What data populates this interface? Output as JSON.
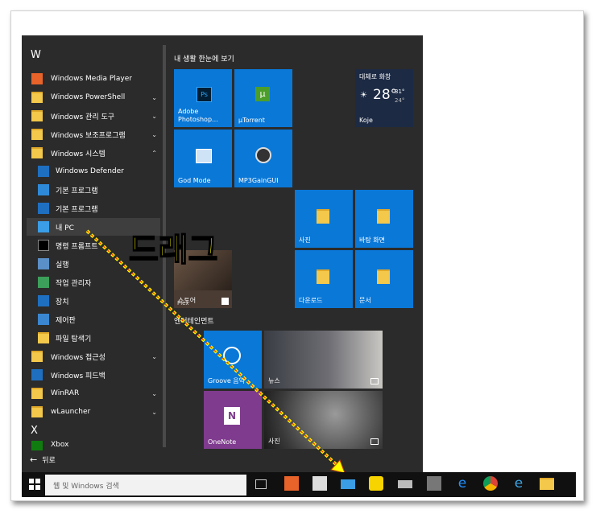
{
  "applist": {
    "group_w": "W",
    "group_x": "X",
    "items": [
      {
        "label": "Windows Media Player",
        "chev": ""
      },
      {
        "label": "Windows PowerShell",
        "chev": "⌄"
      },
      {
        "label": "Windows 관리 도구",
        "chev": "⌄"
      },
      {
        "label": "Windows 보조프로그램",
        "chev": "⌄"
      },
      {
        "label": "Windows 시스템",
        "chev": "⌃"
      },
      {
        "label": "Windows Defender",
        "chev": ""
      },
      {
        "label": "기본 프로그램",
        "chev": ""
      },
      {
        "label": "기본 프로그램",
        "chev": ""
      },
      {
        "label": "내 PC",
        "chev": ""
      },
      {
        "label": "명령 프롬프트",
        "chev": ""
      },
      {
        "label": "실행",
        "chev": ""
      },
      {
        "label": "작업 관리자",
        "chev": ""
      },
      {
        "label": "장치",
        "chev": ""
      },
      {
        "label": "제어판",
        "chev": ""
      },
      {
        "label": "파일 탐색기",
        "chev": ""
      },
      {
        "label": "Windows 접근성",
        "chev": "⌄"
      },
      {
        "label": "Windows 피드백",
        "chev": ""
      },
      {
        "label": "WinRAR",
        "chev": "⌄"
      },
      {
        "label": "wLauncher",
        "chev": "⌄"
      },
      {
        "label": "Xbox",
        "chev": ""
      }
    ],
    "back": "뒤로"
  },
  "tiles": {
    "section1": "내 생활 한눈에 보기",
    "section2": "엔터테인먼트",
    "photoshop": "Adobe Photoshop...",
    "utorrent": "µTorrent",
    "godmode": "God Mode",
    "mp3gain": "MP3GainGUI",
    "weather_title": "대체로 화창",
    "weather_temp": "28°",
    "weather_hi": "31°",
    "weather_lo": "24°",
    "weather_city": "Koje",
    "photos": "사진",
    "wallpaper": "바탕 화면",
    "downloads": "다운로드",
    "documents": "문서",
    "store": "스토어",
    "plex": "Plex",
    "groove": "Groove 음악",
    "news": "뉴스",
    "onenote": "OneNote",
    "photos2": "사진"
  },
  "overlay": {
    "drag_text": "드래그"
  },
  "taskbar": {
    "search_placeholder": "웹 및 Windows 검색"
  }
}
